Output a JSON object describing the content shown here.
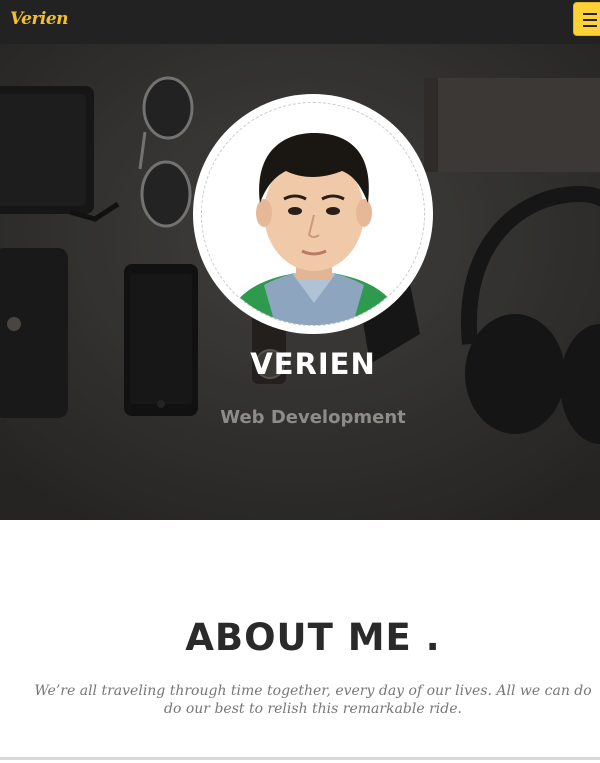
{
  "navbar": {
    "brand": "Verien",
    "menu_toggle_icon": "hamburger-icon",
    "accent_color": "#fed136"
  },
  "hero": {
    "name": "VERIEN",
    "subtitle": "Web Development"
  },
  "about": {
    "title": "ABOUT ME .",
    "line1": "We’re all traveling through time together, every day of our lives. All we can do",
    "line2": "do our best to relish this remarkable ride."
  }
}
